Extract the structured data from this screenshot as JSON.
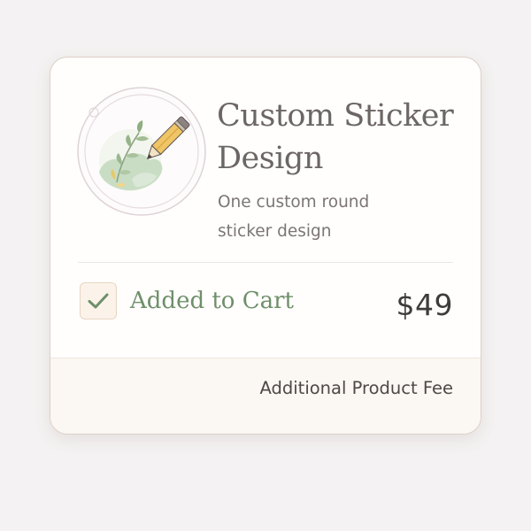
{
  "product": {
    "title": "Custom Sticker Design",
    "description": "One custom round sticker design",
    "image_icon": "pencil-on-leaf-sticker-icon"
  },
  "cart": {
    "status_label": "Added to Cart",
    "checked": true,
    "check_icon": "checkmark-icon",
    "price": "$49"
  },
  "footer": {
    "fee_label": "Additional Product Fee"
  },
  "colors": {
    "accent_green": "#6f8f6a",
    "card_border": "#ddd0c6",
    "checkbox_fill": "#fbf3ea"
  }
}
